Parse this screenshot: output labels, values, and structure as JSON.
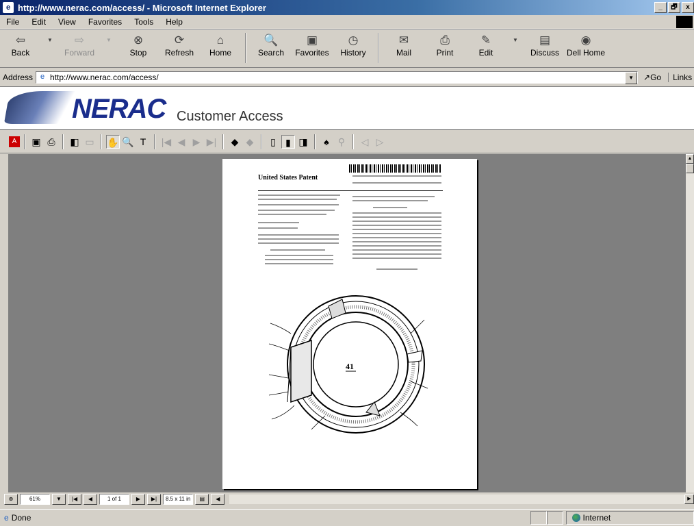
{
  "window": {
    "title": "http://www.nerac.com/access/ - Microsoft Internet Explorer",
    "app_icon": "e",
    "min": "_",
    "max": "🗗",
    "close": "x"
  },
  "menu": [
    "File",
    "Edit",
    "View",
    "Favorites",
    "Tools",
    "Help"
  ],
  "toolbar": {
    "back": "Back",
    "forward": "Forward",
    "stop": "Stop",
    "refresh": "Refresh",
    "home": "Home",
    "search": "Search",
    "favorites": "Favorites",
    "history": "History",
    "mail": "Mail",
    "print": "Print",
    "edit": "Edit",
    "discuss": "Discuss",
    "dell_home": "Dell Home"
  },
  "address": {
    "label": "Address",
    "url": "http://www.nerac.com/access/",
    "go": "Go",
    "links": "Links"
  },
  "banner": {
    "logo": "NERAC",
    "subtitle": "Customer Access"
  },
  "document": {
    "patent_title": "United States Patent",
    "figure_label": "41"
  },
  "bottom_nav": {
    "zoom": "61%",
    "page": "1 of 1",
    "size": "8.5 x 11 in"
  },
  "status": {
    "text": "Done",
    "zone": "Internet"
  }
}
